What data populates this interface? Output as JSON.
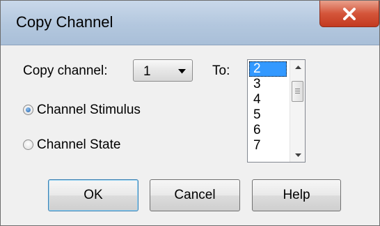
{
  "window": {
    "title": "Copy Channel",
    "close_icon": "close-icon"
  },
  "copy_channel": {
    "label": "Copy channel:",
    "selected_value": "1"
  },
  "to": {
    "label": "To:",
    "items": [
      "2",
      "3",
      "4",
      "5",
      "6",
      "7"
    ],
    "selected": "2"
  },
  "options": {
    "stimulus_label": "Channel Stimulus",
    "stimulus_checked": true,
    "state_label": "Channel State",
    "state_checked": false
  },
  "buttons": {
    "ok": "OK",
    "cancel": "Cancel",
    "help": "Help"
  },
  "colors": {
    "selection": "#3399ff",
    "close_button": "#c7432a",
    "dialog_bg": "#f0f0f0"
  }
}
